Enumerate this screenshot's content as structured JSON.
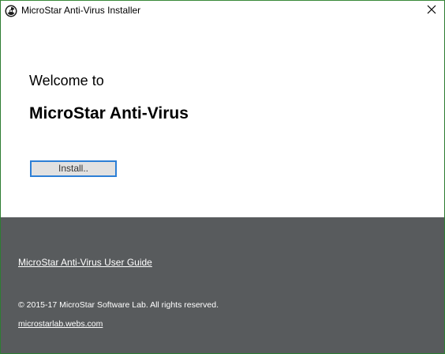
{
  "window": {
    "title": "MicroStar Anti-Virus Installer",
    "app_icon": "radiation-icon",
    "close_icon": "close-icon"
  },
  "main": {
    "welcome_text": "Welcome to",
    "product_name": "MicroStar Anti-Virus",
    "install_label": "Install.."
  },
  "footer": {
    "guide_link": "MicroStar Anti-Virus User Guide",
    "copyright": "© 2015-17 MicroStar Software Lab. All rights reserved.",
    "website": "microstarlab.webs.com"
  },
  "colors": {
    "footer_bg": "#585b5d",
    "button_border": "#2c7fd6",
    "button_bg": "#e1e1e1",
    "window_border": "#2e7d32"
  }
}
